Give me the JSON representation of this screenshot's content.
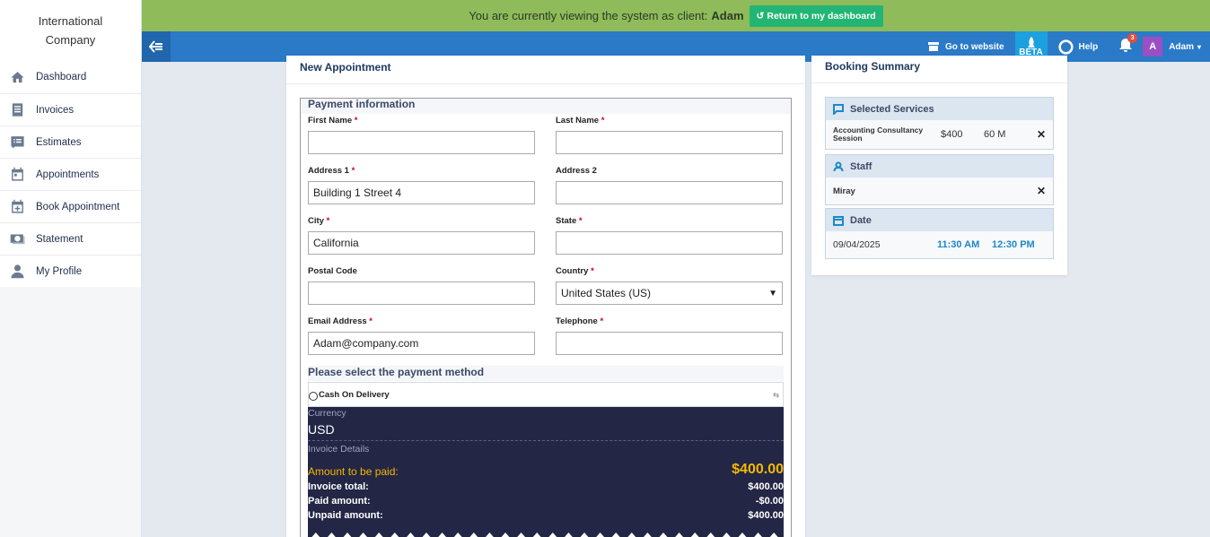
{
  "company": {
    "line1": "International",
    "line2": "Company"
  },
  "sidebar": {
    "items": [
      {
        "label": "Dashboard",
        "icon": "home-icon"
      },
      {
        "label": "Invoices",
        "icon": "invoice-icon"
      },
      {
        "label": "Estimates",
        "icon": "estimate-icon"
      },
      {
        "label": "Appointments",
        "icon": "calendar-icon"
      },
      {
        "label": "Book Appointment",
        "icon": "calendar-plus-icon"
      },
      {
        "label": "Statement",
        "icon": "money-icon"
      },
      {
        "label": "My Profile",
        "icon": "user-icon"
      }
    ]
  },
  "client_bar": {
    "text": "You are currently viewing the system as client:",
    "client_name": "Adam",
    "return_label": "Return to my dashboard"
  },
  "topbar": {
    "website_label": "Go to website",
    "beta_label": "BETA",
    "help_label": "Help",
    "notification_count": "3",
    "avatar_letter": "A",
    "user_name": "Adam"
  },
  "main": {
    "title": "New Appointment",
    "payment_section": "Payment information",
    "fields": {
      "first_name": {
        "label": "First Name",
        "value": ""
      },
      "last_name": {
        "label": "Last Name",
        "value": ""
      },
      "address1": {
        "label": "Address 1",
        "value": "Building 1 Street 4"
      },
      "address2": {
        "label": "Address 2",
        "value": ""
      },
      "city": {
        "label": "City",
        "value": "California"
      },
      "state": {
        "label": "State",
        "value": ""
      },
      "postal": {
        "label": "Postal Code",
        "value": ""
      },
      "country": {
        "label": "Country",
        "value": "United States (US)"
      },
      "email": {
        "label": "Email Address",
        "value": "Adam@company.com"
      },
      "telephone": {
        "label": "Telephone",
        "value": ""
      }
    },
    "required_mark": "*",
    "payment_method_title": "Please select the payment method",
    "payment_option": "Cash On Delivery",
    "invoice": {
      "currency_label": "Currency",
      "currency": "USD",
      "details_label": "Invoice Details",
      "amount_label": "Amount to be paid:",
      "amount": "$400.00",
      "rows": [
        {
          "label": "Invoice total:",
          "value": "$400.00"
        },
        {
          "label": "Paid amount:",
          "value": "-$0.00"
        },
        {
          "label": "Unpaid amount:",
          "value": "$400.00"
        }
      ]
    }
  },
  "summary": {
    "title": "Booking Summary",
    "services_head": "Selected Services",
    "service": {
      "name": "Accounting Consultancy Session",
      "price": "$400",
      "duration": "60 M"
    },
    "staff_head": "Staff",
    "staff_name": "Miray",
    "date_head": "Date",
    "date": "09/04/2025",
    "start": "11:30 AM",
    "end": "12:30 PM",
    "remove_symbol": "✕"
  }
}
